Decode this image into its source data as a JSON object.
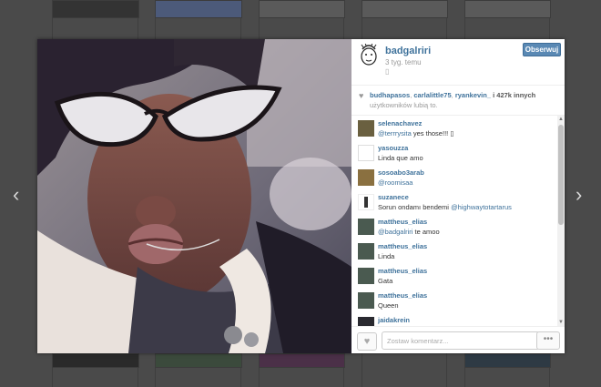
{
  "post": {
    "username": "badgalriri",
    "time_ago": "3 tyg. temu",
    "location_glyph": "▯",
    "follow_label": "Obserwuj"
  },
  "likes": {
    "users": [
      "budhapasos",
      "carlalittle75",
      "ryankevin_"
    ],
    "count_text": "i 427k innych",
    "suffix": "użytkowników lubią to."
  },
  "comments": [
    {
      "user": "selenachavez",
      "mention": "@terrrysita",
      "text": " yes those!!! ▯"
    },
    {
      "user": "yasouzza",
      "mention": "",
      "text": "Linda que amo"
    },
    {
      "user": "sosoabo3arab",
      "mention": "@roomisaa",
      "text": ""
    },
    {
      "user": "suzanece",
      "mention": "@highwaytotartarus",
      "text": "Sorun ondamı bendemi "
    },
    {
      "user": "mattheus_elias",
      "mention": "@badgalriri",
      "text": " te amoo"
    },
    {
      "user": "mattheus_elias",
      "mention": "",
      "text": "Linda"
    },
    {
      "user": "mattheus_elias",
      "mention": "",
      "text": "Gata"
    },
    {
      "user": "mattheus_elias",
      "mention": "",
      "text": "Queen"
    },
    {
      "user": "jaidakrein",
      "mention": "",
      "text": ""
    }
  ],
  "comment_box": {
    "placeholder": "Zostaw komentarz..."
  },
  "icons": {
    "prev": "chevron-left-icon",
    "next": "chevron-right-icon",
    "heart": "heart-icon",
    "more": "more-options-icon"
  },
  "colors": {
    "link": "#3f729b",
    "follow_button": "#5a89b4"
  }
}
